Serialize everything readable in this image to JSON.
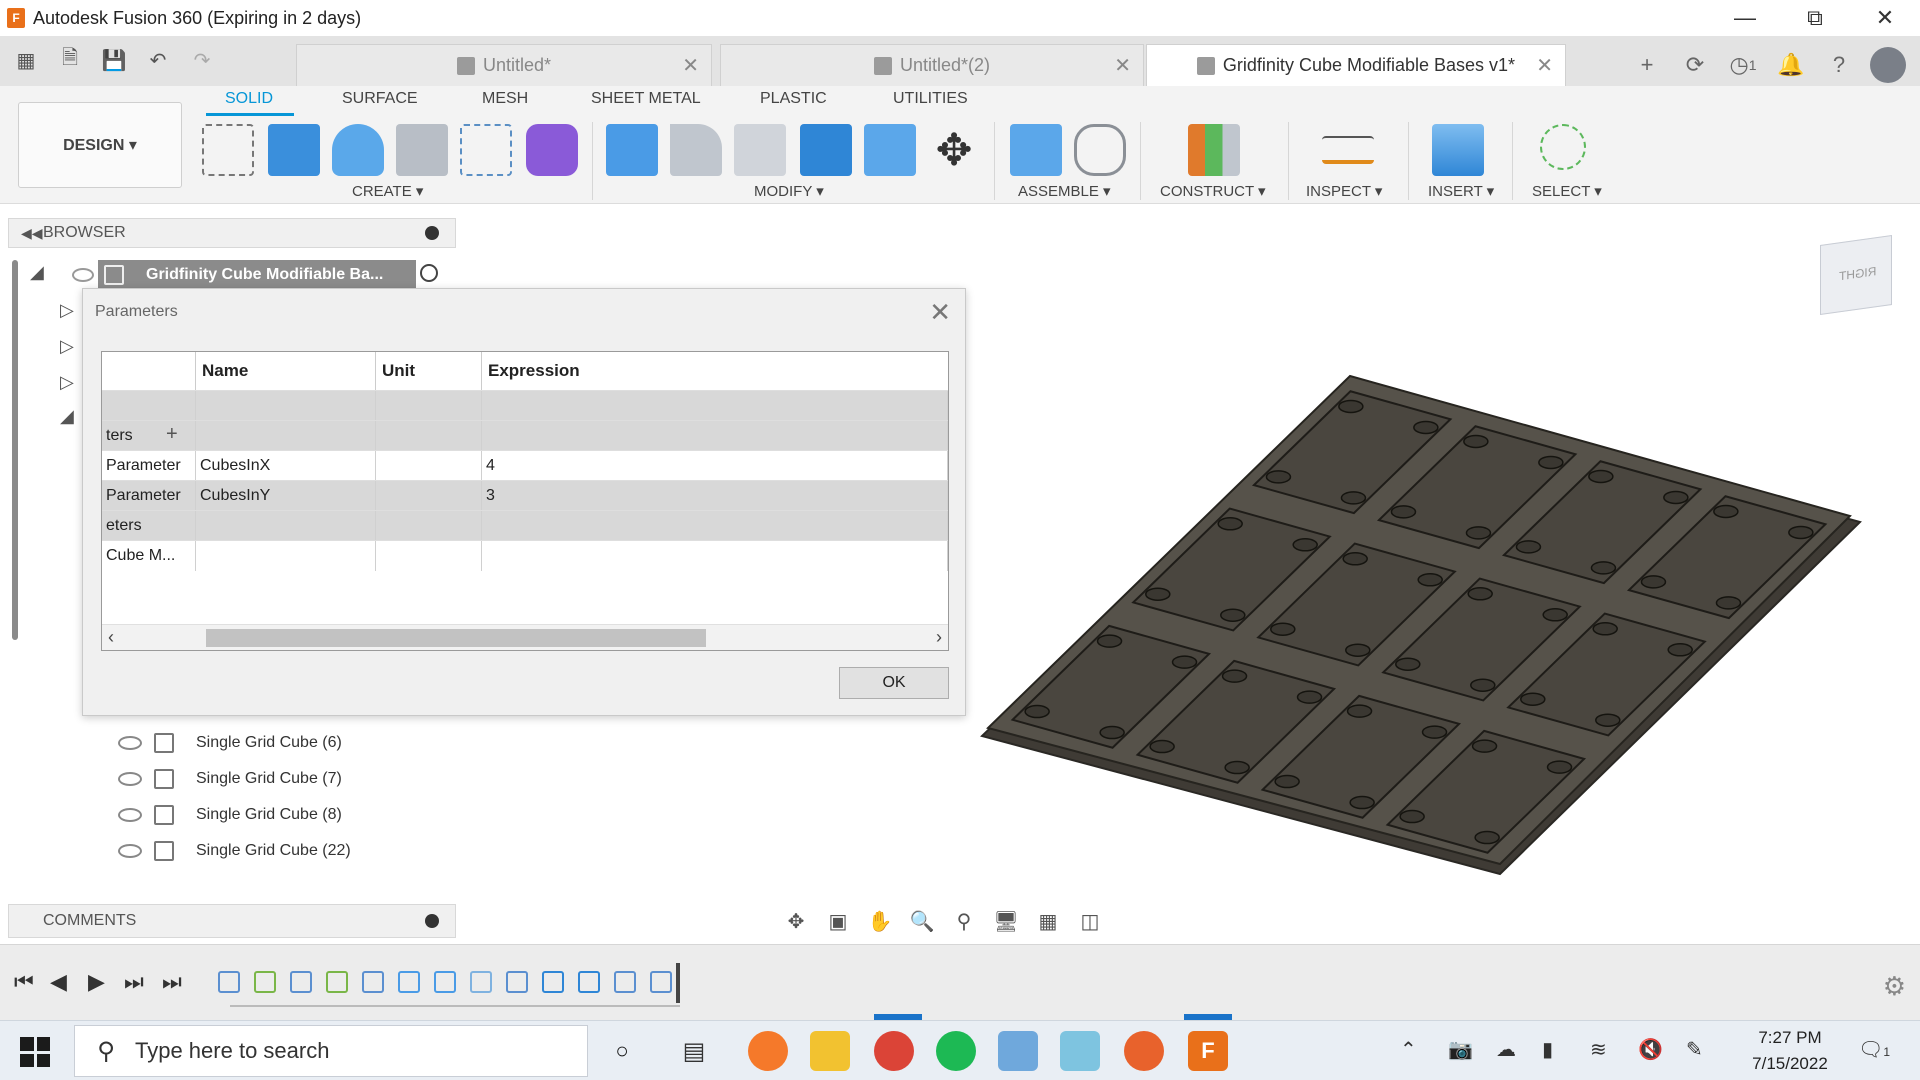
{
  "window": {
    "title": "Autodesk Fusion 360 (Expiring in 2 days)",
    "app_icon": "F",
    "controls": [
      "minimize-icon",
      "restore-icon",
      "close-icon"
    ]
  },
  "tabs": [
    {
      "label": "Untitled*",
      "active": false
    },
    {
      "label": "Untitled*(2)",
      "active": false
    },
    {
      "label": "Gridfinity Cube Modifiable Bases v1*",
      "active": true
    }
  ],
  "tabbar_right": {
    "job_count": "1"
  },
  "ribbon": {
    "workspace_button": "DESIGN ▾",
    "tabs": [
      "SOLID",
      "SURFACE",
      "MESH",
      "SHEET METAL",
      "PLASTIC",
      "UTILITIES"
    ],
    "active_tab": "SOLID",
    "groups": [
      "CREATE ▾",
      "MODIFY ▾",
      "ASSEMBLE ▾",
      "CONSTRUCT ▾",
      "INSPECT ▾",
      "INSERT ▾",
      "SELECT ▾"
    ]
  },
  "browser": {
    "header": "BROWSER",
    "root_label": "Gridfinity Cube Modifiable Ba...",
    "items": [
      "Single Grid Cube (6)",
      "Single Grid Cube (7)",
      "Single Grid Cube (8)",
      "Single Grid Cube (22)"
    ]
  },
  "comments": {
    "header": "COMMENTS"
  },
  "dialog": {
    "title": "Parameters",
    "columns": [
      "Name",
      "Unit",
      "Expression"
    ],
    "rows": [
      {
        "c0": "",
        "name": "",
        "unit": "",
        "expr": "",
        "shade": true
      },
      {
        "c0": "ters",
        "name": "",
        "unit": "",
        "expr": "",
        "shade": true,
        "add": "+"
      },
      {
        "c0": "Parameter",
        "name": "CubesInX",
        "unit": "",
        "expr": "4",
        "shade": false
      },
      {
        "c0": "Parameter",
        "name": "CubesInY",
        "unit": "",
        "expr": "3",
        "shade": true
      },
      {
        "c0": "eters",
        "name": "",
        "unit": "",
        "expr": "",
        "shade": true
      },
      {
        "c0": "Cube M...",
        "name": "",
        "unit": "",
        "expr": "",
        "shade": false
      }
    ],
    "ok_label": "OK"
  },
  "viewcube": {
    "face_label": "RIGHT"
  },
  "taskbar": {
    "search_placeholder": "Type here to search",
    "time": "7:27 PM",
    "date": "7/15/2022",
    "notification_count": "1"
  },
  "colors": {
    "accent": "#0696d7",
    "fusion_orange": "#e9701a",
    "model_dark": "#4a463f"
  }
}
